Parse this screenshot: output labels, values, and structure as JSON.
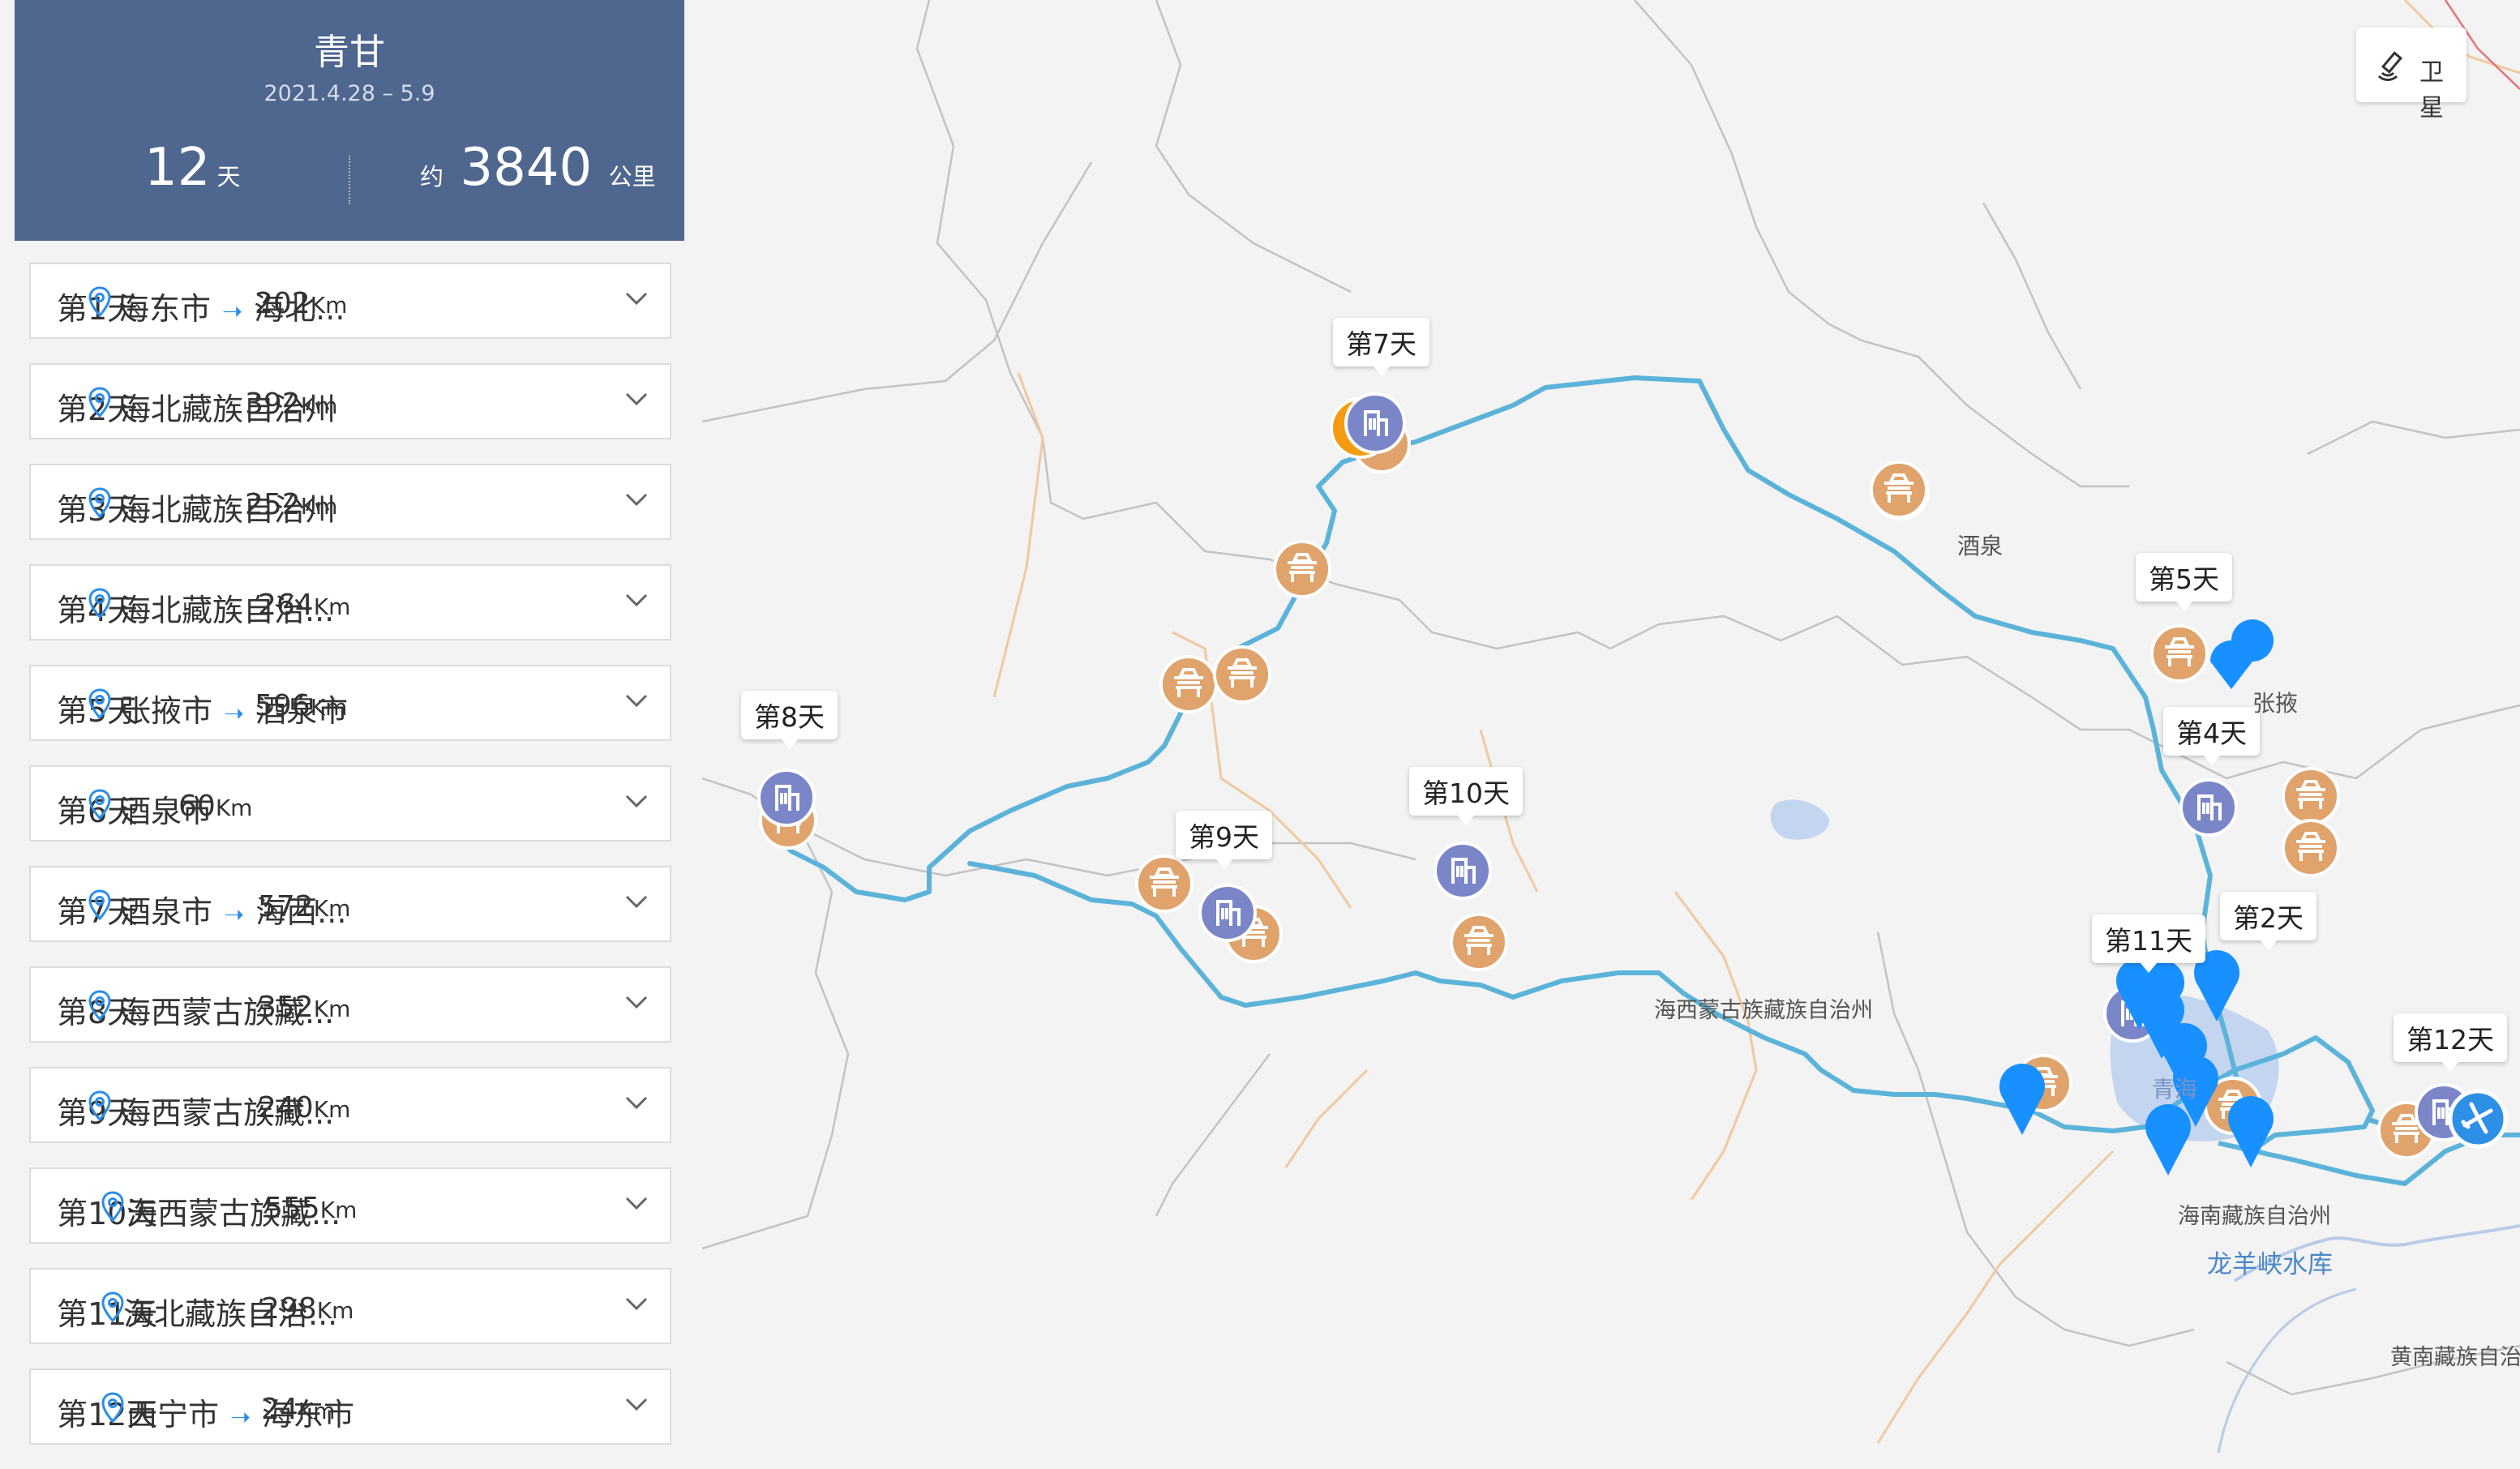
{
  "trip": {
    "title": "青甘",
    "dates": "2021.4.28 – 5.9",
    "days_value": "12",
    "days_unit": "天",
    "distance_prefix": "约",
    "distance_value": "3840",
    "distance_unit": "公里"
  },
  "days": [
    {
      "label": "第1天",
      "from": "海东市",
      "to": "海北...",
      "distance": "202",
      "unit": "Km"
    },
    {
      "label": "第2天",
      "from": "海北藏族自治州",
      "to": "",
      "distance": "392",
      "unit": "Km"
    },
    {
      "label": "第3天",
      "from": "海北藏族自治州",
      "to": "",
      "distance": "252",
      "unit": "Km"
    },
    {
      "label": "第4天",
      "from": "海北藏族自治...",
      "to": "",
      "distance": "264",
      "unit": "Km"
    },
    {
      "label": "第5天",
      "from": "张掖市",
      "to": "酒泉市",
      "distance": "596",
      "unit": "Km"
    },
    {
      "label": "第6天",
      "from": "酒泉市",
      "to": "",
      "distance": "60",
      "unit": "Km"
    },
    {
      "label": "第7天",
      "from": "酒泉市",
      "to": "海西...",
      "distance": "572",
      "unit": "Km"
    },
    {
      "label": "第8天",
      "from": "海西蒙古族藏...",
      "to": "",
      "distance": "352",
      "unit": "Km"
    },
    {
      "label": "第9天",
      "from": "海西蒙古族藏...",
      "to": "",
      "distance": "240",
      "unit": "Km"
    },
    {
      "label": "第10天",
      "from": "海西蒙古族藏...",
      "to": "",
      "distance": "555",
      "unit": "Km"
    },
    {
      "label": "第11天",
      "from": "海北藏族自治...",
      "to": "",
      "distance": "298",
      "unit": "Km"
    },
    {
      "label": "第12天",
      "from": "西宁市",
      "to": "海东市",
      "distance": "24",
      "unit": "Km"
    }
  ],
  "map": {
    "satellite_label": "卫星",
    "callouts": [
      "第7天",
      "第8天",
      "第9天",
      "第10天",
      "第5天",
      "第4天",
      "第11天",
      "第2天",
      "第12天"
    ],
    "places": {
      "jiuquan": "酒泉",
      "zhangye": "张掖",
      "haixi": "海西蒙古族藏族自治州",
      "qinghai_lake": "青海",
      "hainan": "海南藏族自治州",
      "longyangxia": "龙羊峡水库",
      "huangnan": "黄南藏族自治"
    },
    "colors": {
      "route": "#5bb3d9",
      "scenic_marker": "#e0a36b",
      "hotel_marker": "#7b86c9",
      "poi_pin": "#1890ff",
      "header": "#4f668f"
    }
  }
}
